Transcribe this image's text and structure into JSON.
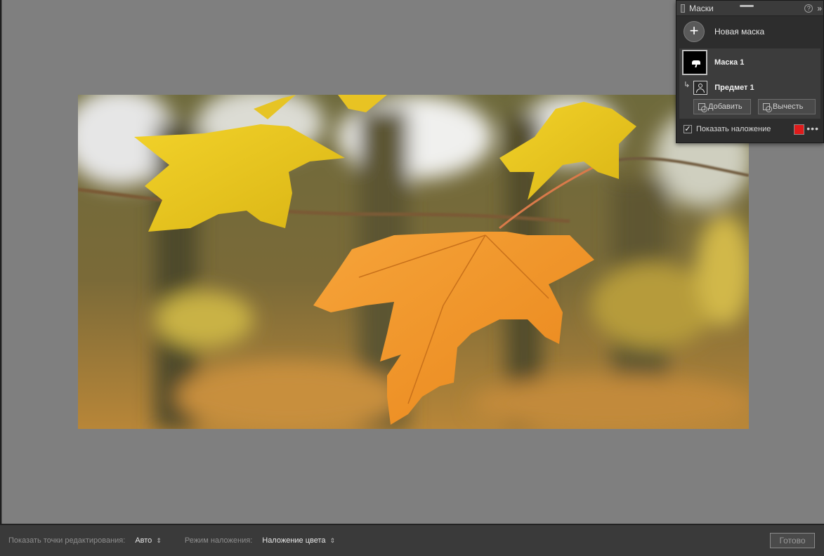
{
  "masks_panel": {
    "title": "Маски",
    "help_label": "?",
    "expand_label": "»",
    "new_mask_label": "Новая маска",
    "mask_name": "Маска 1",
    "component_name": "Предмет 1",
    "add_label": "Добавить",
    "subtract_label": "Вычесть",
    "overlay_label": "Показать наложение",
    "overlay_checked": true,
    "overlay_color": "#e01b1b"
  },
  "toolbar": {
    "edit_points_label": "Показать точки редактирования:",
    "edit_points_value": "Авто",
    "blend_mode_label": "Режим наложения:",
    "blend_mode_value": "Наложение цвета",
    "done_label": "Готово"
  },
  "photo": {
    "subject": "maple-leaves",
    "accent_colors": [
      "#f0b12a",
      "#e9c21a",
      "#7a6a3a"
    ]
  }
}
